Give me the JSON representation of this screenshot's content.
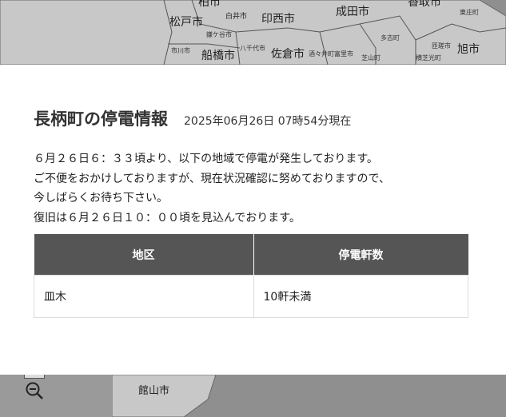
{
  "map": {
    "labels": [
      {
        "text": "柏市",
        "cls": "big"
      },
      {
        "text": "松戸市",
        "cls": "big"
      },
      {
        "text": "白井市",
        "cls": ""
      },
      {
        "text": "印西市",
        "cls": "big"
      },
      {
        "text": "成田市",
        "cls": "big"
      },
      {
        "text": "香取市",
        "cls": "big"
      },
      {
        "text": "東庄町",
        "cls": "small"
      },
      {
        "text": "鎌ケ谷市",
        "cls": "small"
      },
      {
        "text": "市川市",
        "cls": "small"
      },
      {
        "text": "船橋市",
        "cls": "big"
      },
      {
        "text": "八千代市",
        "cls": "small"
      },
      {
        "text": "佐倉市",
        "cls": "big"
      },
      {
        "text": "酒々井町",
        "cls": "small"
      },
      {
        "text": "富里市",
        "cls": "small"
      },
      {
        "text": "多古町",
        "cls": "small"
      },
      {
        "text": "匝瑳市",
        "cls": "small"
      },
      {
        "text": "芝山町",
        "cls": "small"
      },
      {
        "text": "横芝光町",
        "cls": "small"
      },
      {
        "text": "旭市",
        "cls": "big"
      },
      {
        "text": "館山市",
        "cls": ""
      }
    ]
  },
  "dialog": {
    "title": "長柄町の停電情報",
    "timestamp": "2025年06月26日 07時54分現在",
    "message_lines": [
      "６月２６日６：３３頃より、以下の地域で停電が発生しております。",
      "ご不便をおかけしておりますが、現在状況確認に努めておりますので、",
      "今しばらくお待ち下さい。",
      "復旧は６月２６日１０：００頃を見込んでおります。"
    ],
    "table": {
      "headers": [
        "地区",
        "停電軒数"
      ],
      "rows": [
        [
          "皿木",
          "10軒未満"
        ]
      ]
    }
  },
  "controls": {
    "zoom_out_icon": "zoom-out-icon"
  }
}
